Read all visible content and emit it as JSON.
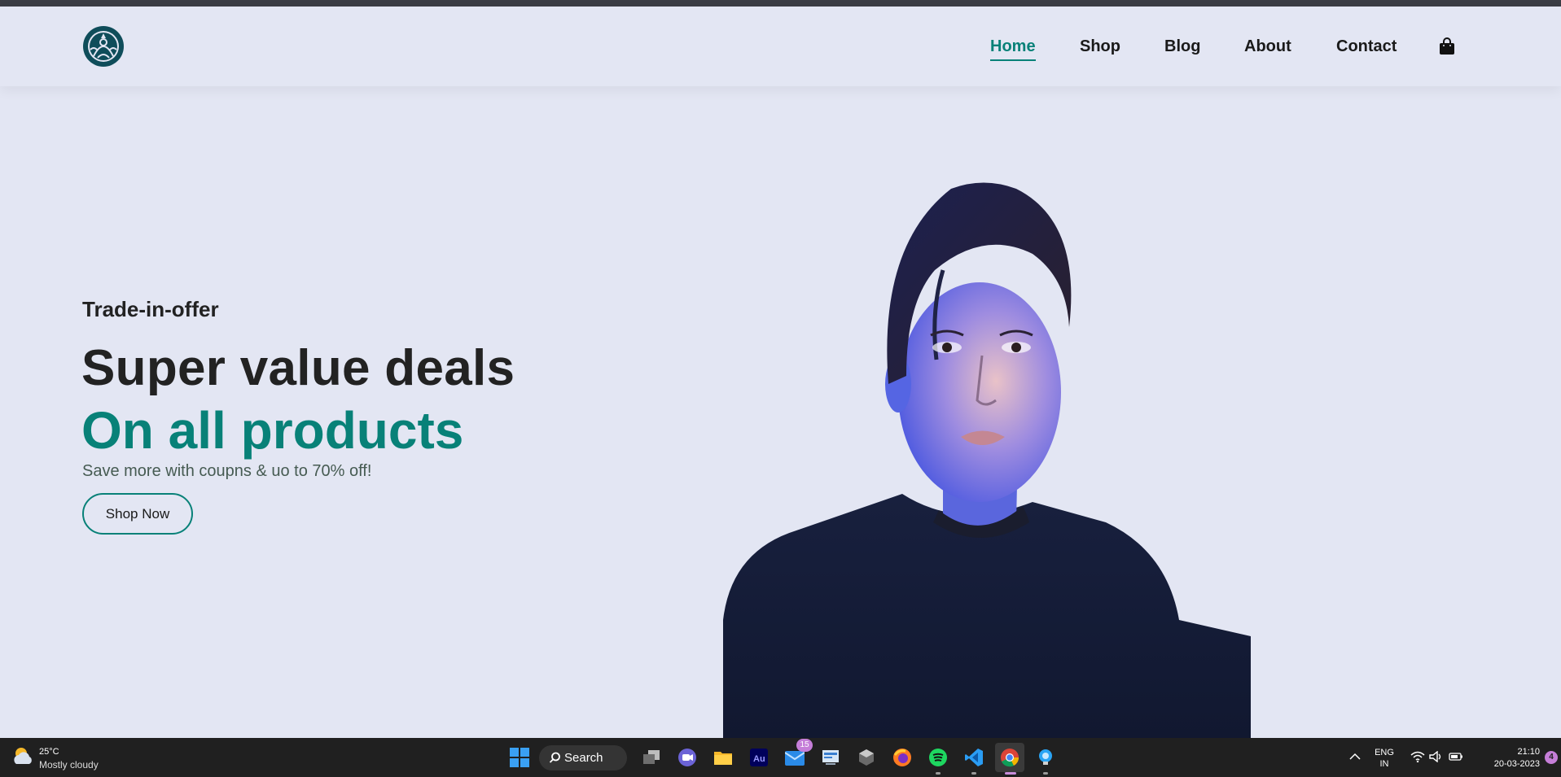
{
  "nav": {
    "home": "Home",
    "shop": "Shop",
    "blog": "Blog",
    "about": "About",
    "contact": "Contact"
  },
  "hero": {
    "kicker": "Trade-in-offer",
    "headline": "Super value deals",
    "headline_accent": "On all products",
    "subtext": "Save more with coupns & uo to 70% off!",
    "cta_label": "Shop Now"
  },
  "colors": {
    "accent": "#088178",
    "background": "#e3e6f3",
    "heading": "#222222",
    "taskbar": "#202020"
  },
  "icons": {
    "logo": "starbucks-siren-logo",
    "cart": "shopping-bag-icon"
  },
  "taskbar": {
    "weather_temp": "25°C",
    "weather_condition": "Mostly cloudy",
    "search_label": "Search",
    "mail_badge": "15",
    "lang_line1": "ENG",
    "lang_line2": "IN",
    "time": "21:10",
    "date": "20-03-2023",
    "notification_count": "4",
    "apps": [
      "start",
      "search",
      "task-view",
      "teams-chat",
      "file-explorer",
      "audition",
      "mail",
      "control-panel",
      "app-3d",
      "firefox",
      "spotify",
      "vscode",
      "chrome",
      "bulb-app"
    ]
  }
}
